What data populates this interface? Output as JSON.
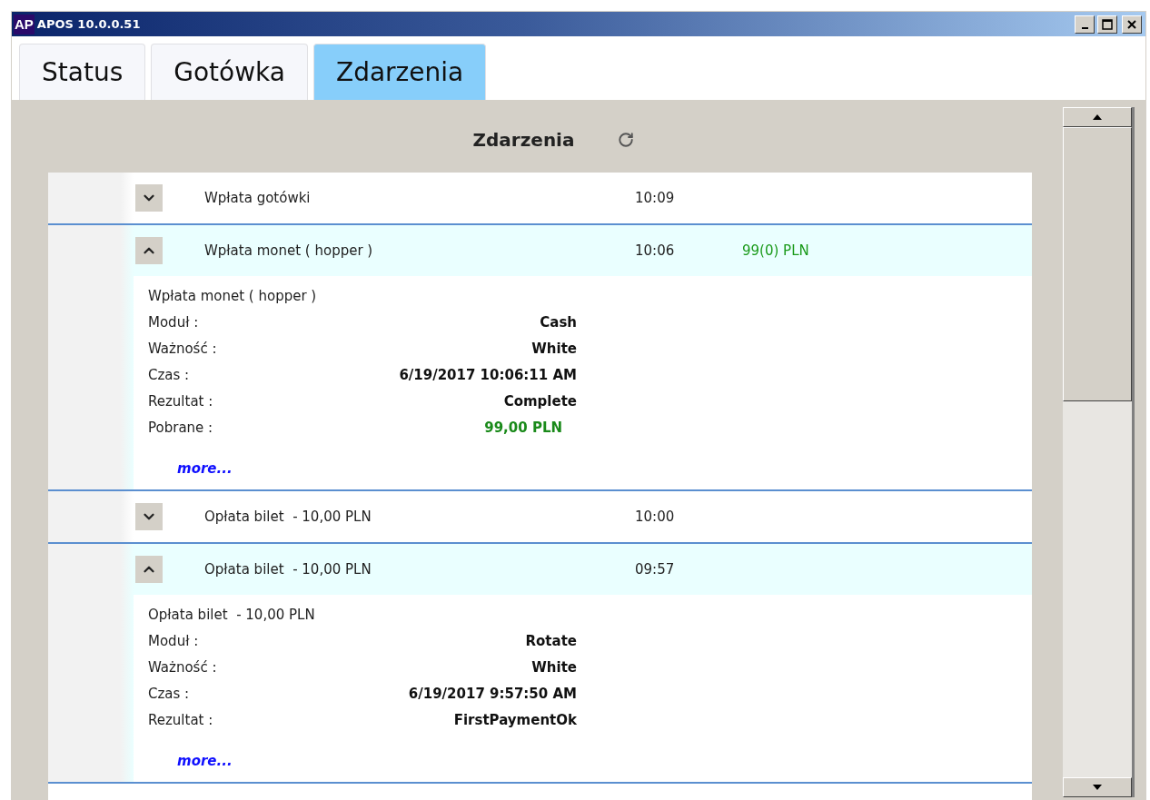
{
  "window": {
    "logo": "AP",
    "title": "APOS 10.0.0.51"
  },
  "tabs": [
    {
      "label": "Status",
      "selected": false
    },
    {
      "label": "Gotówka",
      "selected": false
    },
    {
      "label": "Zdarzenia",
      "selected": true
    }
  ],
  "panel": {
    "title": "Zdarzenia"
  },
  "events": [
    {
      "title": "Wpłata gotówki",
      "time": "10:09",
      "expanded": false
    },
    {
      "title": "Wpłata monet ( hopper )",
      "time": "10:06",
      "amount": "99(0) PLN",
      "expanded": true,
      "details": {
        "title": "Wpłata monet ( hopper )",
        "fields": [
          {
            "label": "Moduł :",
            "value": "Cash",
            "kind": "plain"
          },
          {
            "label": "Ważność :",
            "value": "White",
            "kind": "plain"
          },
          {
            "label": "Czas :",
            "value": "6/19/2017 10:06:11 AM",
            "kind": "plain"
          },
          {
            "label": "Rezultat :",
            "value": "Complete",
            "kind": "plain"
          },
          {
            "label": "Pobrane :",
            "value": "99,00 PLN",
            "kind": "amount"
          }
        ],
        "link": "more..."
      }
    },
    {
      "title": "Opłata bilet  - 10,00 PLN",
      "time": "10:00",
      "expanded": false
    },
    {
      "title": "Opłata bilet  - 10,00 PLN",
      "time": "09:57",
      "expanded": true,
      "details": {
        "title": "Opłata bilet  - 10,00 PLN",
        "fields": [
          {
            "label": "Moduł :",
            "value": "Rotate",
            "kind": "plain"
          },
          {
            "label": "Ważność :",
            "value": "White",
            "kind": "plain"
          },
          {
            "label": "Czas :",
            "value": "6/19/2017 9:57:50 AM",
            "kind": "plain"
          },
          {
            "label": "Rezultat :",
            "value": "FirstPaymentOk",
            "kind": "plain"
          }
        ],
        "link": "more..."
      }
    }
  ]
}
